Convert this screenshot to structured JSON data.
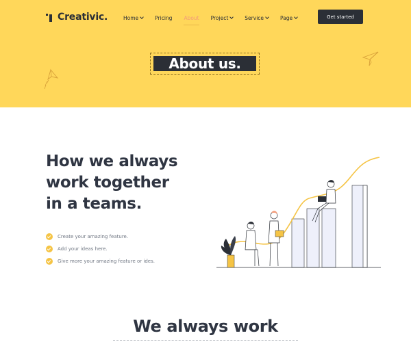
{
  "brand": {
    "name": "Creativic."
  },
  "nav": {
    "items": [
      {
        "label": "Home",
        "dropdown": true,
        "active": false
      },
      {
        "label": "Pricing",
        "dropdown": false,
        "active": false
      },
      {
        "label": "About",
        "dropdown": false,
        "active": true
      },
      {
        "label": "Project",
        "dropdown": true,
        "active": false
      },
      {
        "label": "Service",
        "dropdown": true,
        "active": false
      },
      {
        "label": "Page",
        "dropdown": true,
        "active": false
      }
    ],
    "cta_label": "Get started"
  },
  "hero": {
    "title": "About us."
  },
  "intro": {
    "headline_lines": [
      "How we always",
      "work together",
      "in a teams."
    ],
    "features": [
      "Create your amazing feature.",
      "Add your ideas here.",
      "Give more your amazing feature or ides."
    ]
  },
  "next_section": {
    "title": "We always work"
  },
  "colors": {
    "hero_bg": "#ffd75a",
    "dark": "#2b2f36",
    "accent_yellow": "#f5c445",
    "active_link": "#f39c7a"
  },
  "icons": {
    "logo": "logo-mark-icon",
    "plane": "paper-plane-icon",
    "check": "check-circle-icon",
    "chevron": "chevron-down-icon"
  }
}
